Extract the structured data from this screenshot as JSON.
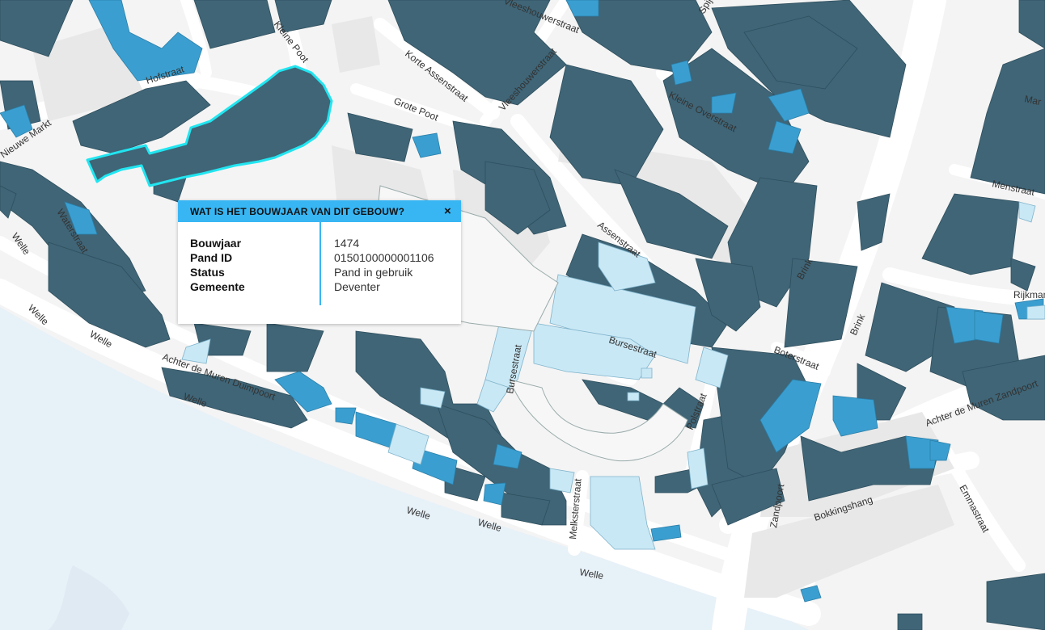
{
  "popup": {
    "title": "WAT IS HET BOUWJAAR VAN DIT GEBOUW?",
    "close_label": "×",
    "fields": [
      {
        "label": "Bouwjaar",
        "value": "1474"
      },
      {
        "label": "Pand ID",
        "value": "0150100000001106"
      },
      {
        "label": "Status",
        "value": "Pand in gebruik"
      },
      {
        "label": "Gemeente",
        "value": "Deventer"
      }
    ]
  },
  "map": {
    "colors": {
      "background": "#f4f4f4",
      "water": "#e7f1f8",
      "road": "#ffffff",
      "building_old": "#3f6577",
      "building_mid": "#3a9fd0",
      "building_new": "#c9e8f5",
      "selected_outline": "#21e5f0"
    },
    "street_labels": [
      {
        "name": "Hofstraat"
      },
      {
        "name": "Nieuwe Markt"
      },
      {
        "name": "Kleine Poot"
      },
      {
        "name": "Korte Assenstraat"
      },
      {
        "name": "Grote Poot"
      },
      {
        "name": "Vleeshouwerstraat"
      },
      {
        "name": "Kleine Overstraat"
      },
      {
        "name": "Menstraat"
      },
      {
        "name": "Rijkman"
      },
      {
        "name": "Waterstraat"
      },
      {
        "name": "Welle"
      },
      {
        "name": "Welle"
      },
      {
        "name": "Welle"
      },
      {
        "name": "Welle"
      },
      {
        "name": "Welle"
      },
      {
        "name": "Welle"
      },
      {
        "name": "Welle"
      },
      {
        "name": "Achter de Muren Duimpoort"
      },
      {
        "name": "Assenstraat"
      },
      {
        "name": "Bursestraat"
      },
      {
        "name": "Bursestraat"
      },
      {
        "name": "Brink"
      },
      {
        "name": "Brink"
      },
      {
        "name": "Boterstraat"
      },
      {
        "name": "Achter de Muren Zandpoort"
      },
      {
        "name": "Polstraat"
      },
      {
        "name": "Zandpoort"
      },
      {
        "name": "Melksterstraat"
      },
      {
        "name": "Bokkingshang"
      },
      {
        "name": "Emmastraat"
      },
      {
        "name": "Mar"
      },
      {
        "name": "Spijkerstraat"
      },
      {
        "name": "Vleeshouwerstraat"
      }
    ]
  }
}
